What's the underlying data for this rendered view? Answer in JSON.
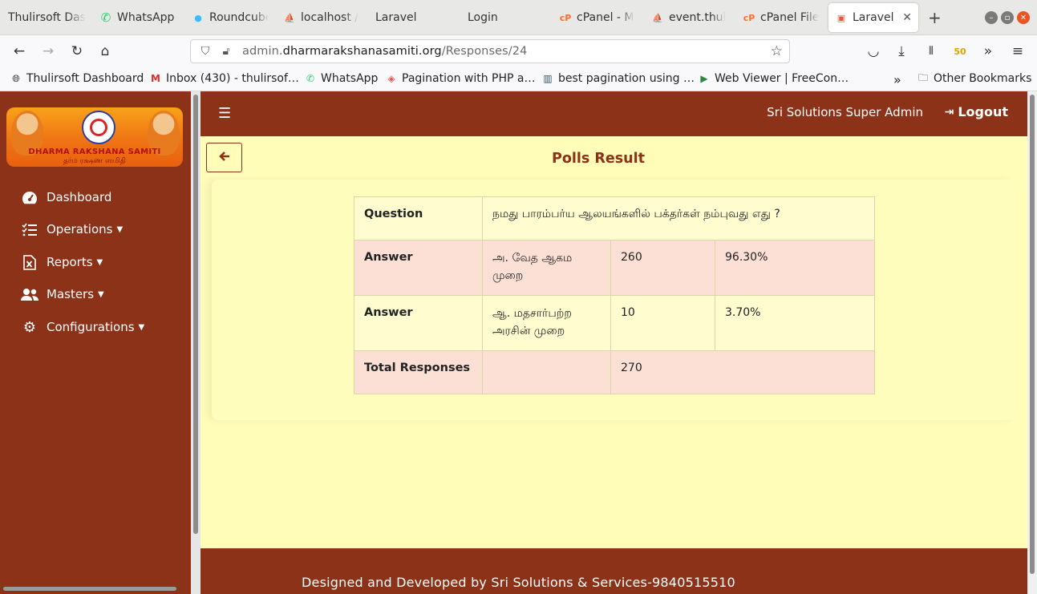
{
  "browser": {
    "tabs": [
      {
        "title": "Thulirsoft Das",
        "icon": "thulirsoft-icon"
      },
      {
        "title": "WhatsApp",
        "icon": "whatsapp-icon"
      },
      {
        "title": "Roundcube",
        "icon": "roundcube-icon"
      },
      {
        "title": "localhost /",
        "icon": "phpmyadmin-icon"
      },
      {
        "title": "Laravel",
        "icon": ""
      },
      {
        "title": "Login",
        "icon": ""
      },
      {
        "title": "cPanel - M",
        "icon": "cpanel-icon"
      },
      {
        "title": "event.thul",
        "icon": "phpmyadmin-icon"
      },
      {
        "title": "cPanel File",
        "icon": "cpanel-icon"
      },
      {
        "title": "Laravel",
        "icon": "laravel-icon"
      }
    ],
    "url_domain_prefix": "admin.",
    "url_domain": "dharmarakshanasamiti.org",
    "url_path": "/Responses/24",
    "extension_badge": "50",
    "bookmarks": [
      {
        "label": "Thulirsoft Dashboard",
        "icon": "globe-icon"
      },
      {
        "label": "Inbox (430) - thulirsof…",
        "icon": "gmail-icon"
      },
      {
        "label": "WhatsApp",
        "icon": "whatsapp-icon"
      },
      {
        "label": "Pagination with PHP a…",
        "icon": "bookmark-icon"
      },
      {
        "label": "best pagination using …",
        "icon": "bookmark-icon"
      },
      {
        "label": "Web Viewer | FreeCon…",
        "icon": "play-icon"
      }
    ],
    "other_bookmarks": "Other Bookmarks"
  },
  "logo": {
    "english": "DHARMA RAKSHANA SAMITI",
    "tamil": "தர்ம ரக்ஷண ஸமிதி"
  },
  "sidebar": {
    "items": [
      {
        "label": "Dashboard",
        "icon": "dashboard-icon",
        "dropdown": false
      },
      {
        "label": "Operations",
        "icon": "list-check-icon",
        "dropdown": true
      },
      {
        "label": "Reports",
        "icon": "excel-file-icon",
        "dropdown": true
      },
      {
        "label": "Masters",
        "icon": "users-icon",
        "dropdown": true
      },
      {
        "label": "Configurations",
        "icon": "gears-icon",
        "dropdown": true
      }
    ]
  },
  "topbar": {
    "user": "Sri Solutions Super Admin",
    "logout": "Logout"
  },
  "page": {
    "title": "Polls Result"
  },
  "poll": {
    "question_label": "Question",
    "question": "நமது பாரம்பர்ய ஆலயங்களில் பக்தர்கள் நம்புவது எது ?",
    "answers": [
      {
        "label": "Answer",
        "option": "அ. வேத ஆகம முறை",
        "count": "260",
        "percent": "96.30%"
      },
      {
        "label": "Answer",
        "option": "ஆ. மதசார்பற்ற அரசின் முறை",
        "count": "10",
        "percent": "3.70%"
      }
    ],
    "total_label": "Total Responses",
    "total": "270"
  },
  "footer": {
    "text": "Designed and Developed by Sri Solutions & Services-9840515510"
  },
  "colors": {
    "brand": "#8b3218",
    "content_bg": "#fffdb8",
    "row_yellow": "#fffdd0",
    "row_pink": "#fce0d6"
  }
}
